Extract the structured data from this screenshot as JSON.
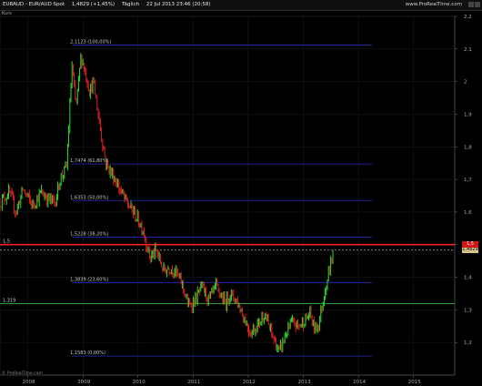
{
  "header": {
    "symbol": "EURAUD - EUR/AUD Spot",
    "price": "1,4829 (+1,45%)",
    "period": "Täglich",
    "datetime": "22 Jul 2013 23:46 (20:58)",
    "brand": "www.ProRealTime.com"
  },
  "subheader": "Kurs",
  "footer": "© ProRealTime.com",
  "chart_data": {
    "type": "candlestick",
    "x_ticks": [
      "2008",
      "2009",
      "2010",
      "2011",
      "2012",
      "2013",
      "2014",
      "2015"
    ],
    "y_ticks": [
      "1,2",
      "1,3",
      "1,4",
      "1,5",
      "1,6",
      "1,7",
      "1,8",
      "1,9",
      "2",
      "2,1",
      "2,2"
    ],
    "ylim": [
      1.1,
      2.2
    ],
    "colors": {
      "up": "#2ee02e",
      "down": "#e02020",
      "fib": "#2a2ab8",
      "resistance": "#ff2020",
      "support": "#30b030",
      "last": "#dddddd"
    },
    "fib_levels": [
      {
        "label": "2,1123 (100,00%)",
        "value": 2.1123
      },
      {
        "label": "1,7474 (61,80%)",
        "value": 1.7474
      },
      {
        "label": "1,6353 (50,00%)",
        "value": 1.6353
      },
      {
        "label": "1,5228 (38,20%)",
        "value": 1.5228
      },
      {
        "label": "1,3839 (23,60%)",
        "value": 1.3839
      },
      {
        "label": "1,1583 (0,00%)",
        "value": 1.1583
      }
    ],
    "horizontal_lines": [
      {
        "label": "1,5",
        "value": 1.5,
        "kind": "resistance"
      },
      {
        "label": "1,319",
        "value": 1.319,
        "kind": "support"
      }
    ],
    "last_price": {
      "label": "1,4829",
      "value": 1.4829
    },
    "series": [
      {
        "points": [
          [
            "2007-07-01",
            1.63
          ],
          [
            "2007-09-01",
            1.66
          ],
          [
            "2007-10-15",
            1.6
          ],
          [
            "2007-12-01",
            1.67
          ],
          [
            "2008-02-01",
            1.62
          ],
          [
            "2008-04-01",
            1.66
          ],
          [
            "2008-05-15",
            1.64
          ],
          [
            "2008-07-01",
            1.63
          ],
          [
            "2008-08-01",
            1.7
          ],
          [
            "2008-09-15",
            1.74
          ],
          [
            "2008-10-20",
            2.05
          ],
          [
            "2008-11-15",
            1.92
          ],
          [
            "2008-12-20",
            2.08
          ],
          [
            "2009-02-15",
            1.97
          ],
          [
            "2009-03-10",
            2.0
          ],
          [
            "2009-04-15",
            1.89
          ],
          [
            "2009-06-01",
            1.75
          ],
          [
            "2009-08-01",
            1.7
          ],
          [
            "2009-10-15",
            1.63
          ],
          [
            "2009-12-01",
            1.6
          ],
          [
            "2010-02-01",
            1.55
          ],
          [
            "2010-03-20",
            1.46
          ],
          [
            "2010-05-01",
            1.48
          ],
          [
            "2010-06-20",
            1.42
          ],
          [
            "2010-08-01",
            1.43
          ],
          [
            "2010-09-01",
            1.42
          ],
          [
            "2010-10-20",
            1.38
          ],
          [
            "2010-12-01",
            1.31
          ],
          [
            "2011-01-15",
            1.33
          ],
          [
            "2011-03-01",
            1.37
          ],
          [
            "2011-04-15",
            1.33
          ],
          [
            "2011-06-01",
            1.37
          ],
          [
            "2011-08-01",
            1.32
          ],
          [
            "2011-09-01",
            1.35
          ],
          [
            "2011-10-15",
            1.33
          ],
          [
            "2011-12-01",
            1.28
          ],
          [
            "2012-01-15",
            1.23
          ],
          [
            "2012-03-15",
            1.26
          ],
          [
            "2012-04-15",
            1.29
          ],
          [
            "2012-06-01",
            1.23
          ],
          [
            "2012-07-25",
            1.17
          ],
          [
            "2012-09-01",
            1.22
          ],
          [
            "2012-10-15",
            1.26
          ],
          [
            "2012-12-01",
            1.25
          ],
          [
            "2013-01-15",
            1.27
          ],
          [
            "2013-02-15",
            1.29
          ],
          [
            "2013-03-15",
            1.24
          ],
          [
            "2013-04-15",
            1.26
          ],
          [
            "2013-05-15",
            1.34
          ],
          [
            "2013-06-15",
            1.41
          ],
          [
            "2013-07-22",
            1.4829
          ]
        ]
      }
    ]
  }
}
